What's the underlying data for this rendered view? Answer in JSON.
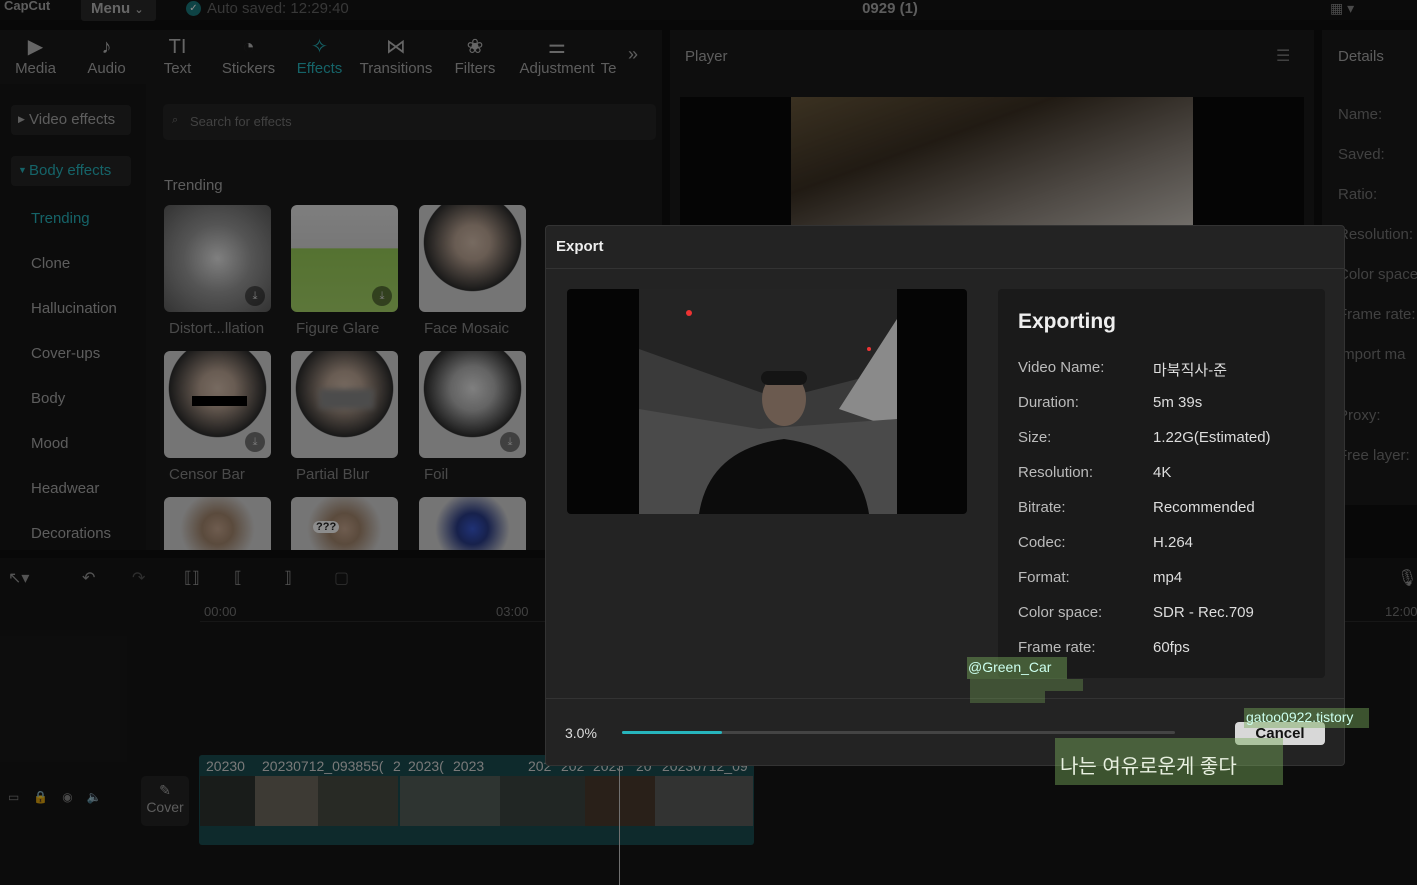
{
  "app": {
    "logo": "CapCut",
    "menu_label": "Menu",
    "menu_caret": "⌄",
    "autosave": "Auto saved: 12:29:40",
    "project_title": "0929 (1)"
  },
  "toolbar": {
    "tabs": [
      {
        "label": "Media",
        "icon": "▶"
      },
      {
        "label": "Audio",
        "icon": "♪"
      },
      {
        "label": "Text",
        "icon": "TI"
      },
      {
        "label": "Stickers",
        "icon": "◔"
      },
      {
        "label": "Effects",
        "icon": "✧"
      },
      {
        "label": "Transitions",
        "icon": "⋈"
      },
      {
        "label": "Filters",
        "icon": "❀"
      },
      {
        "label": "Adjustment",
        "icon": "⚌"
      },
      {
        "label": "Te",
        "icon": ""
      }
    ],
    "more": "»"
  },
  "effects_sidebar": {
    "video_effects": "Video effects",
    "body_effects": "Body effects",
    "items": [
      "Trending",
      "Clone",
      "Hallucination",
      "Cover-ups",
      "Body",
      "Mood",
      "Headwear",
      "Decorations"
    ]
  },
  "search": {
    "placeholder": "Search for effects"
  },
  "trending": {
    "title": "Trending",
    "cards": [
      "Distort...llation",
      "Figure Glare",
      "Face Mosaic",
      "Censor Bar",
      "Partial Blur",
      "Foil"
    ]
  },
  "player": {
    "title": "Player"
  },
  "details": {
    "title": "Details",
    "labels": [
      "Name:",
      "Saved:",
      "Ratio:",
      "Resolution:",
      "Color space:",
      "Frame rate:",
      "Import ma",
      "Proxy:",
      "Free layer:"
    ]
  },
  "timeline": {
    "ticks": [
      "00:00",
      "03:00",
      "12:00"
    ],
    "cover_label": "Cover",
    "clip_labels": [
      "20230",
      "20230712_093855(",
      "2",
      "2023(",
      "2023",
      "202",
      "202",
      "2023(",
      "20",
      "20230712_09"
    ],
    "overlay_texts": [
      "@Green_Car",
      "gatoo0922.tistory",
      "나는 여유로운게 좋다"
    ]
  },
  "export": {
    "title": "Export",
    "status": "Exporting",
    "fields": [
      {
        "label": "Video Name:",
        "value": "마북직사-준"
      },
      {
        "label": "Duration:",
        "value": "5m 39s"
      },
      {
        "label": "Size:",
        "value": "1.22G(Estimated)"
      },
      {
        "label": "Resolution:",
        "value": "4K"
      },
      {
        "label": "Bitrate:",
        "value": "Recommended"
      },
      {
        "label": "Codec:",
        "value": "H.264"
      },
      {
        "label": "Format:",
        "value": "mp4"
      },
      {
        "label": "Color space:",
        "value": "SDR - Rec.709"
      },
      {
        "label": "Frame rate:",
        "value": "60fps"
      }
    ],
    "progress_text": "3.0%",
    "progress": 0.03,
    "cancel_label": "Cancel"
  },
  "colors": {
    "accent": "#27b5bd",
    "clip_track": "#1b4e51",
    "modal_bg": "#232323"
  }
}
